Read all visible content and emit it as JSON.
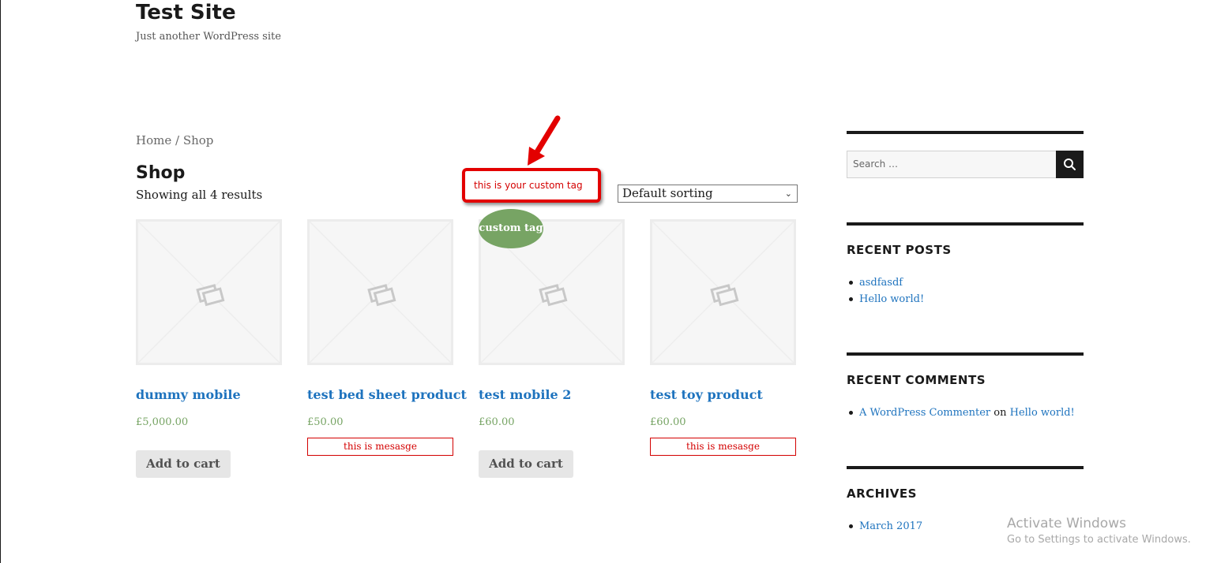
{
  "site": {
    "title": "Test Site",
    "description": "Just another WordPress site"
  },
  "breadcrumb": {
    "home": "Home",
    "separator": " / ",
    "current": "Shop"
  },
  "shop": {
    "title": "Shop",
    "result_count": "Showing all 4 results",
    "sorting": "Default sorting",
    "callout": "this is your custom tag",
    "badge": "custom tag"
  },
  "products": [
    {
      "name": "dummy mobile",
      "price": "£5,000.00",
      "action": "Add to cart",
      "message": ""
    },
    {
      "name": "test bed sheet product",
      "price": "£50.00",
      "action": "",
      "message": "this is mesasge"
    },
    {
      "name": "test mobile 2",
      "price": "£60.00",
      "action": "Add to cart",
      "message": ""
    },
    {
      "name": "test toy product",
      "price": "£60.00",
      "action": "",
      "message": "this is mesasge"
    }
  ],
  "sidebar": {
    "search_placeholder": "Search …",
    "recent_posts": {
      "title": "RECENT POSTS",
      "items": [
        "asdfasdf",
        "Hello world!"
      ]
    },
    "recent_comments": {
      "title": "RECENT COMMENTS",
      "author": "A WordPress Commenter",
      "on": "on",
      "post": "Hello world!"
    },
    "archives": {
      "title": "ARCHIVES",
      "items": [
        "March 2017"
      ]
    }
  },
  "watermark": {
    "line1": "Activate Windows",
    "line2": "Go to Settings to activate Windows."
  },
  "colors": {
    "link": "#1e73be",
    "price": "#77a464",
    "badge": "#77a464",
    "callout": "#e30000"
  }
}
